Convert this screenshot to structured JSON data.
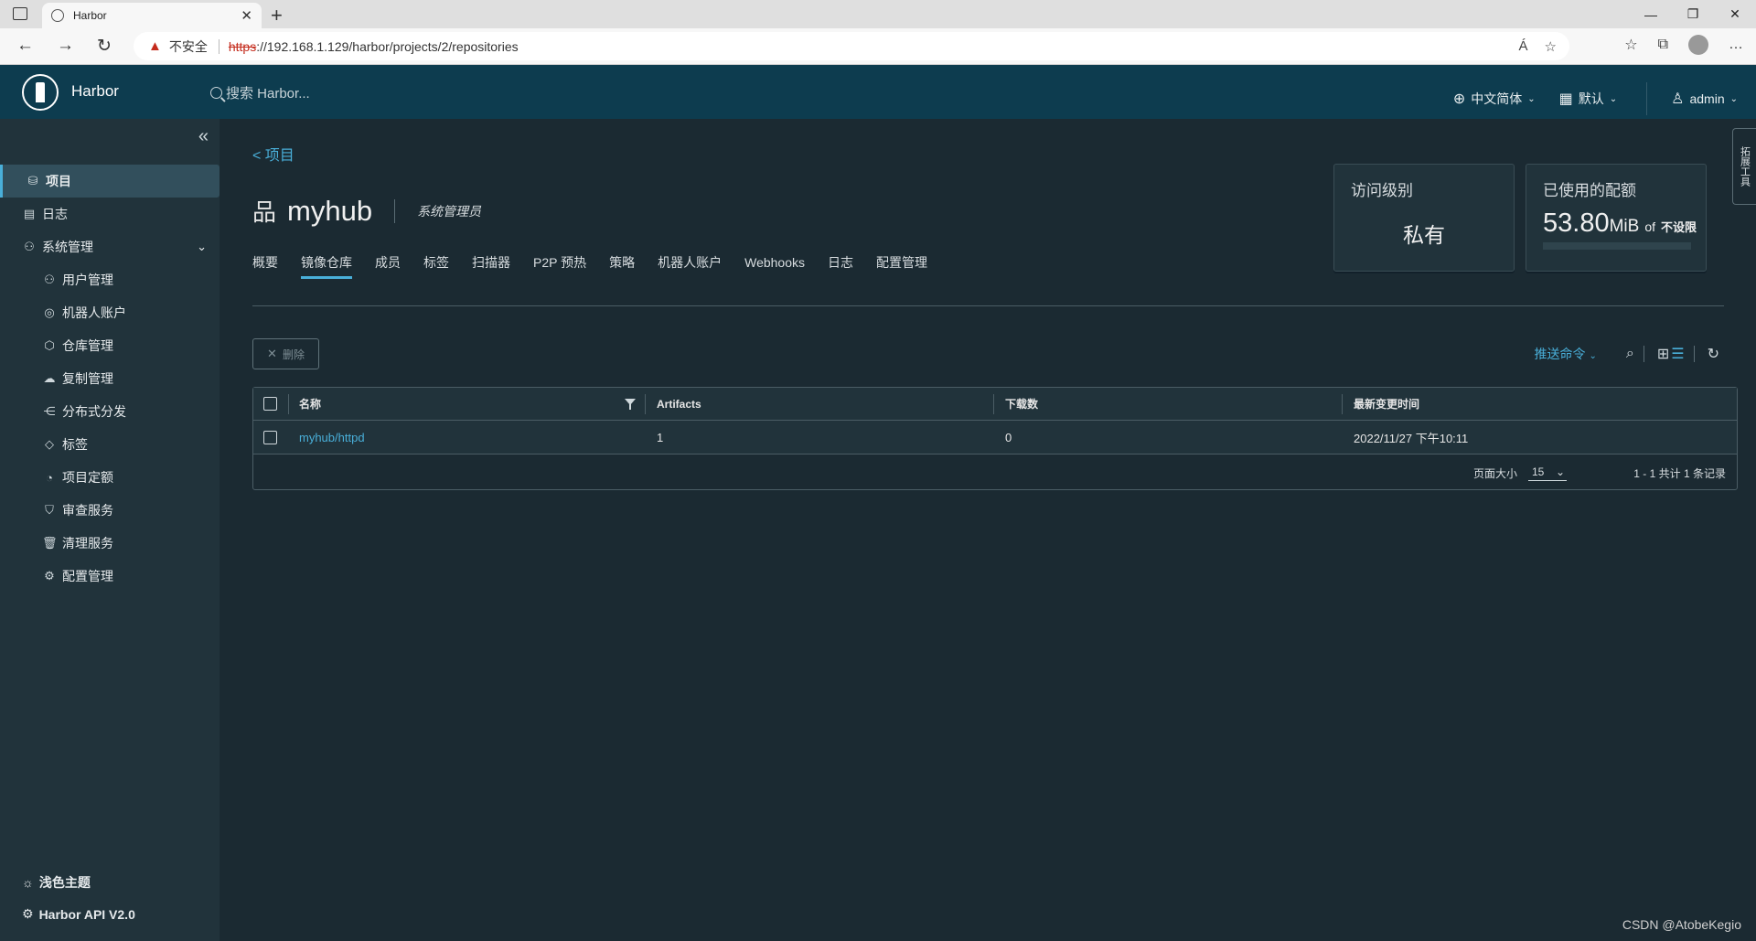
{
  "browser": {
    "tab_title": "Harbor",
    "tab_close": "✕",
    "new_tab": "+",
    "window_buttons": [
      "—",
      "❐",
      "✕"
    ],
    "nav": {
      "back": "←",
      "forward": "→",
      "reload": "↻"
    },
    "warning_icon": "▲",
    "insecure_label": "不安全",
    "url_scheme": "https",
    "url_rest": "://192.168.1.129/harbor/projects/2/repositories",
    "url_right_icons": [
      "Á",
      "☆"
    ],
    "toolbar_icons": [
      "☆",
      "⧉",
      "…"
    ]
  },
  "header": {
    "brand": "Harbor",
    "search_placeholder": "搜索 Harbor...",
    "language": "中文简体",
    "theme_default": "默认",
    "user": "admin"
  },
  "sidebar": {
    "collapse_icon": "«",
    "items": [
      {
        "icon": "⛁",
        "label": "项目"
      },
      {
        "icon": "▤",
        "label": "日志"
      },
      {
        "icon": "⚇",
        "label": "系统管理"
      },
      {
        "icon": "⚇",
        "label": "用户管理"
      },
      {
        "icon": "◎",
        "label": "机器人账户"
      },
      {
        "icon": "⬡",
        "label": "仓库管理"
      },
      {
        "icon": "☁",
        "label": "复制管理"
      },
      {
        "icon": "⋲",
        "label": "分布式分发"
      },
      {
        "icon": "◇",
        "label": "标签"
      },
      {
        "icon": "◔",
        "label": "项目定额"
      },
      {
        "icon": "⛉",
        "label": "审查服务"
      },
      {
        "icon": "🗑",
        "label": "清理服务"
      },
      {
        "icon": "⚙",
        "label": "配置管理"
      }
    ],
    "chevron": "⌄",
    "bottom": [
      {
        "icon": "☼",
        "label": "浅色主题"
      },
      {
        "icon": "⚙",
        "label": "Harbor API V2.0"
      }
    ]
  },
  "main": {
    "back_link": "<  项目",
    "project_icon": "品",
    "project_name": "myhub",
    "role": "系统管理员",
    "access_card": {
      "title": "访问级别",
      "value": "私有"
    },
    "quota_card": {
      "title": "已使用的配额",
      "value": "53.80",
      "unit": "MiB",
      "of": "of",
      "limit": "不设限",
      "used_fraction": 0
    },
    "tabs": [
      "概要",
      "镜像仓库",
      "成员",
      "标签",
      "扫描器",
      "P2P 预热",
      "策略",
      "机器人账户",
      "Webhooks",
      "日志",
      "配置管理"
    ],
    "active_tab": "镜像仓库",
    "delete_icon": "✕",
    "delete_button": "删除",
    "push_command": "推送命令",
    "toolbar_icons": {
      "search": "⌕",
      "grid": "⊞",
      "list": "☰",
      "refresh": "↻"
    },
    "columns": [
      "名称",
      "Artifacts",
      "下载数",
      "最新变更时间"
    ],
    "rows": [
      {
        "name": "myhub/httpd",
        "artifacts": "1",
        "pulls": "0",
        "updated": "2022/11/27 下午10:11"
      }
    ],
    "page_size_label": "页面大小",
    "page_size": "15",
    "page_info": "1 - 1 共计 1 条记录"
  },
  "floating_tab": "拓展工具",
  "watermark": "CSDN @AtobeKegio",
  "colors": {
    "header_bg": "#0d3c4f",
    "sidebar_bg": "#21333b",
    "main_bg": "#1b2a32",
    "accent": "#49afd9"
  }
}
